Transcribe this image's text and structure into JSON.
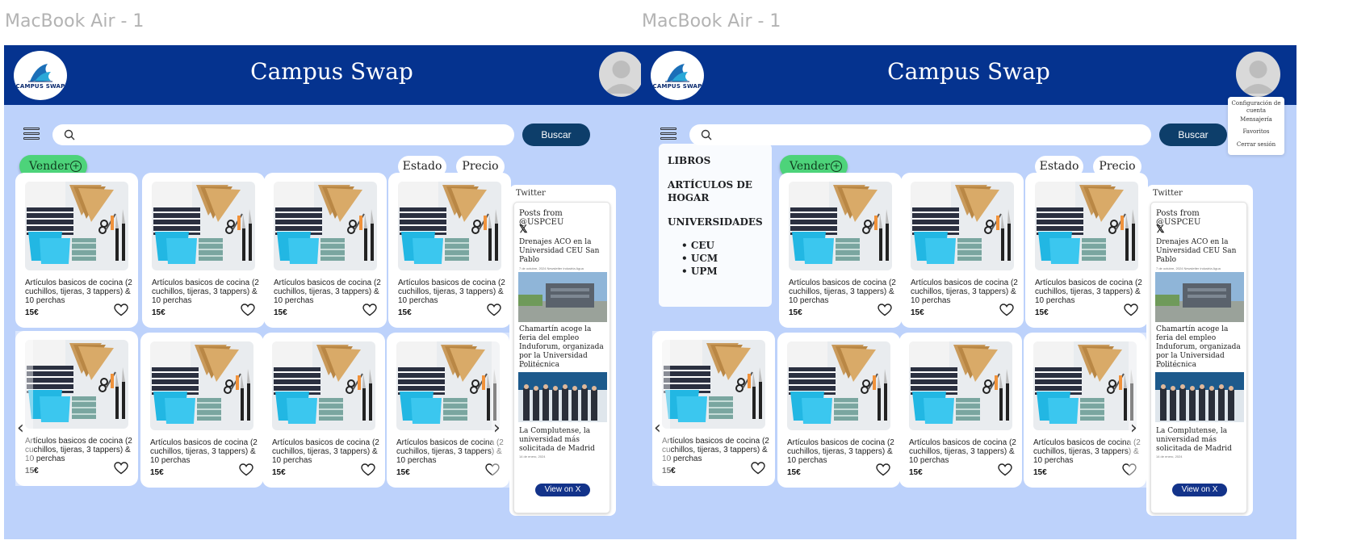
{
  "frames": [
    {
      "label": "MacBook Air - 1"
    },
    {
      "label": "MacBook Air - 1"
    }
  ],
  "header": {
    "app_title": "Campus Swap",
    "logo_text": "CAMPUS SWAP"
  },
  "search": {
    "placeholder": "",
    "button_label": "Buscar"
  },
  "toolbar": {
    "sell_label": "Vender",
    "filter_state": "Estado",
    "filter_price": "Precio"
  },
  "product": {
    "title": "Artículos basicos de cocina (2 cuchillos, tijeras, 3 tappers) & 10 perchas",
    "price": "15€"
  },
  "twitter": {
    "label": "Twitter",
    "header": "Posts from @USPCEU",
    "x_icon": "𝕏",
    "posts": [
      {
        "text": "Drenajes ACO en la Universidad CEU San Pablo",
        "date": "7 de octubre, 2024 Newsletter industria Agua"
      },
      {
        "text": "Chamartín acoge la feria del empleo Induforum, organizada por la Universidad Politécnica",
        "date": "15 de abril, 2024"
      },
      {
        "text": "La Complutense, la universidad más solicitada de Madrid",
        "date": "14 de enero, 2024"
      }
    ],
    "view_button": "View on X"
  },
  "categories": {
    "items": [
      "LIBROS",
      "ARTÍCULOS DE HOGAR",
      "UNIVERSIDADES"
    ],
    "universities": [
      "CEU",
      "UCM",
      "UPM"
    ]
  },
  "account_menu": {
    "items": [
      "Configuración de cuenta",
      "Mensajería",
      "Favoritos",
      "Cerrar sesión"
    ]
  },
  "colors": {
    "header": "#05338f",
    "background": "#bdd2fb",
    "search_button": "#0d3e6a",
    "sell_button": "#4dd37a",
    "view_button": "#13338a"
  },
  "icons": [
    "menu-icon",
    "search-icon",
    "plus-circle-icon",
    "heart-icon",
    "chevron-left-icon",
    "chevron-right-icon",
    "x-logo-icon",
    "avatar-icon"
  ]
}
